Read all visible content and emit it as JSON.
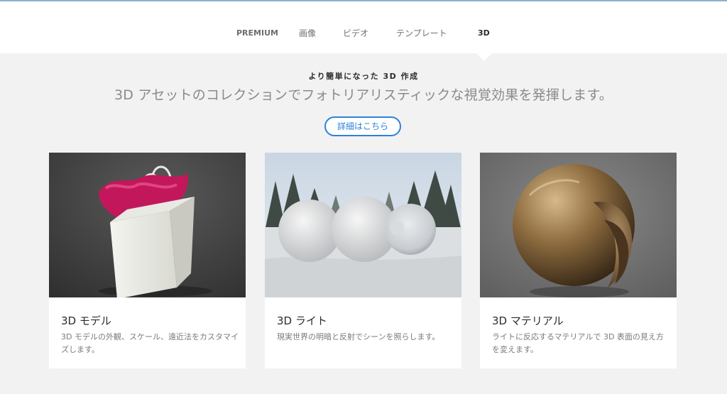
{
  "tabs": [
    {
      "label": "PREMIUM",
      "active": false
    },
    {
      "label": "画像",
      "active": false
    },
    {
      "label": "ビデオ",
      "active": false
    },
    {
      "label": "テンプレート",
      "active": false
    },
    {
      "label": "3D",
      "active": true
    }
  ],
  "hero": {
    "kicker": "より簡単になった 3D 作成",
    "headline": "3D アセットのコレクションでフォトリアリスティックな視覚効果を発揮します。",
    "button_label": "詳細はこちら"
  },
  "cards": [
    {
      "title": "3D モデル",
      "description": "3D モデルの外観、スケール、遠近法をカスタマイズします。",
      "image": "shopping-bag-render"
    },
    {
      "title": "3D ライト",
      "description": "現実世界の明暗と反射でシーンを照らします。",
      "image": "spheres-in-snowy-forest"
    },
    {
      "title": "3D マテリアル",
      "description": "ライトに反応するマテリアルで 3D 表面の見え方を変えます。",
      "image": "bronze-sphere-material"
    }
  ],
  "colors": {
    "accent": "#2d82d8",
    "page_background": "#f2f2f2",
    "card_background": "#ffffff"
  }
}
